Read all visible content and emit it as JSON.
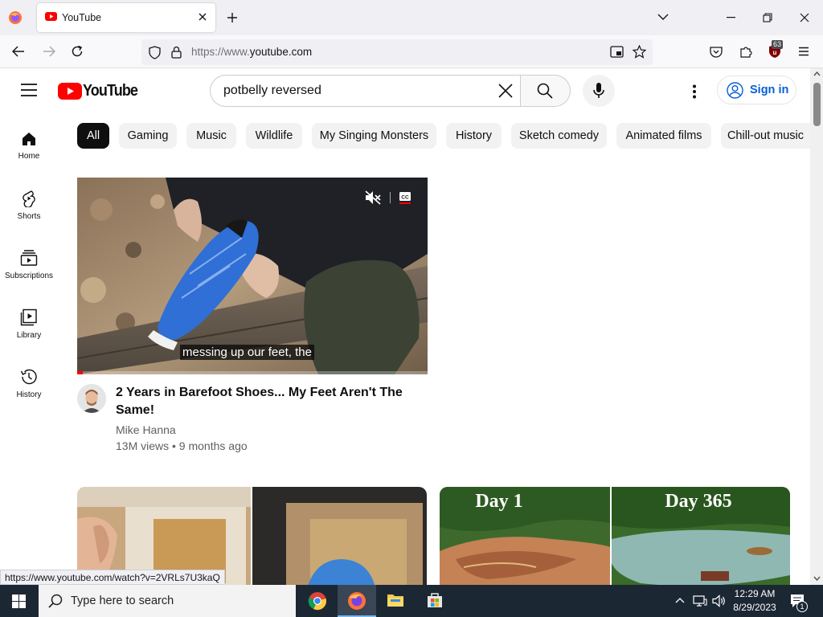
{
  "browser": {
    "tab_title": "YouTube",
    "url_prefix": "https://www.",
    "url_main": "youtube.com",
    "ublock_badge": "63",
    "status_url": "https://www.youtube.com/watch?v=2VRLs7U3kaQ"
  },
  "youtube": {
    "logo_text": "YouTube",
    "search_query": "potbelly reversed",
    "sign_in_label": "Sign in",
    "chips": [
      "All",
      "Gaming",
      "Music",
      "Wildlife",
      "My Singing Monsters",
      "History",
      "Sketch comedy",
      "Animated films",
      "Chill-out music"
    ],
    "active_chip": "All",
    "guide": [
      {
        "label": "Home",
        "icon": "home-icon"
      },
      {
        "label": "Shorts",
        "icon": "shorts-icon"
      },
      {
        "label": "Subscriptions",
        "icon": "subscriptions-icon"
      },
      {
        "label": "Library",
        "icon": "library-icon"
      },
      {
        "label": "History",
        "icon": "history-icon"
      }
    ],
    "featured_video": {
      "caption": "messing up our feet, the",
      "title": "2 Years in Barefoot Shoes... My Feet Aren't The Same!",
      "channel": "Mike Hanna",
      "meta": "13M views • 9 months ago",
      "progress_fraction": 0.015
    },
    "next_thumb_right": {
      "left_label": "Day 1",
      "right_label": "Day 365"
    }
  },
  "taskbar": {
    "search_placeholder": "Type here to search",
    "time": "12:29 AM",
    "date": "8/29/2023",
    "notification_count": "1"
  },
  "colors": {
    "youtube_red": "#ff0000",
    "link_blue": "#065fd4",
    "taskbar": "#1c2734"
  }
}
